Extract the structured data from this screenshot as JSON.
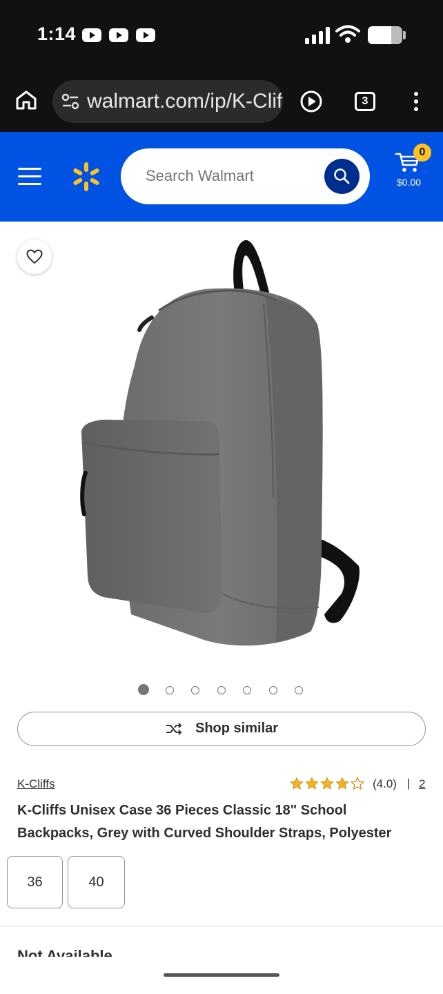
{
  "status_bar": {
    "time": "1:14",
    "notification_icons": [
      "youtube-icon",
      "youtube-icon",
      "youtube-icon"
    ],
    "signal_icon": "signal-icon",
    "wifi_icon": "wifi-icon",
    "battery_icon": "battery-icon",
    "battery_level": 0.68
  },
  "browser": {
    "url": "walmart.com/ip/K-Cliffs",
    "tab_count": "3"
  },
  "header": {
    "search_placeholder": "Search Walmart",
    "cart_count": "0",
    "cart_total": "$0.00",
    "brand_color": "#0053e2",
    "accent_color": "#ffc220"
  },
  "gallery": {
    "image_count": 7,
    "active_index": 0
  },
  "shop_similar_label": "Shop similar",
  "product": {
    "brand": "K-Cliffs",
    "rating_value": 4,
    "rating_max": 5,
    "rating_text": "(4.0)",
    "separator": "|",
    "review_count": "2",
    "title": "K-Cliffs Unisex Case 36 Pieces Classic 18\" School Backpacks, Grey with Curved Shoulder Straps, Polyester",
    "variants": [
      "36",
      "40"
    ]
  },
  "availability_heading": "Not Available"
}
